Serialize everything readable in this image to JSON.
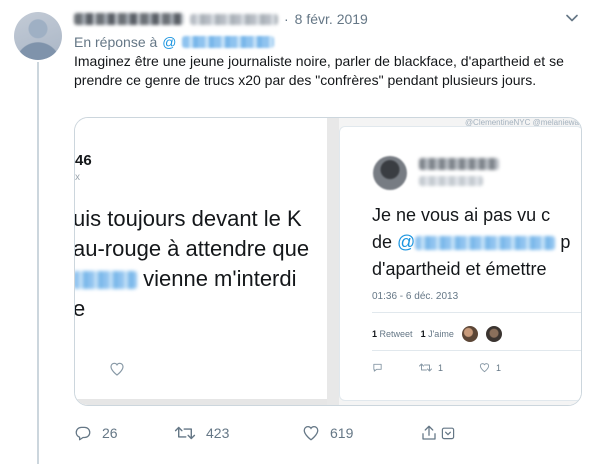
{
  "tweet": {
    "date": "8 févr. 2019",
    "dot": "·",
    "reply_prefix": "En réponse à",
    "reply_at": "@",
    "text": "Imaginez être une jeune journaliste noire, parler de blackface, d'apartheid et se prendre ce genre de trucs x20 par des \"confrères\" pendant plusieurs jours.",
    "stats": {
      "replies": "26",
      "retweets": "423",
      "likes": "619"
    }
  },
  "media": {
    "left": {
      "number": "46",
      "x_mark": "x",
      "line1": "uis toujours devant le K",
      "line2": "au-rouge à attendre que",
      "line3_suffix": " vienne m'interdi",
      "line4": "e"
    },
    "right": {
      "top_strip": "@ClementineNYC @melaniewa",
      "line1": "Je ne vous ai pas vu c",
      "line2_prefix": "de ",
      "line2_at": "@",
      "line2_suffix": " p",
      "line3": "d'apartheid et émettre",
      "timestamp": "01:36 - 6 déc. 2013",
      "retweet_count": "1",
      "retweet_label": "Retweet",
      "like_count": "1",
      "like_label": "J'aime",
      "rt_action_count": "1",
      "like_action_count": "1"
    }
  },
  "colors": {
    "accent": "#1b95e0",
    "muted": "#657786",
    "border": "#ccd6dd"
  }
}
